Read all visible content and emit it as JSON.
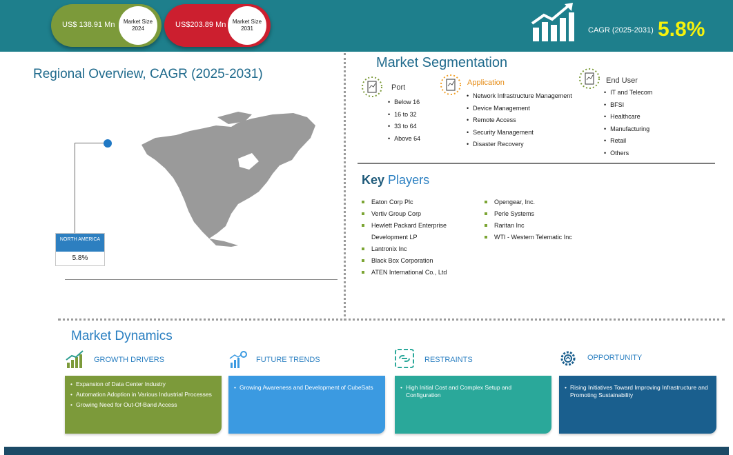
{
  "header": {
    "market_size_2024_value": "US$ 138.91 Mn",
    "market_size_2024_label": "Market Size 2024",
    "market_size_2031_value": "US$203.89 Mn",
    "market_size_2031_label": "Market Size 2031",
    "cagr_label": "CAGR (2025-2031)",
    "cagr_value": "5.8%",
    "colors": {
      "band": "#1e7f8c",
      "green": "#7c9a3a",
      "red": "#cc1f2f",
      "cagr": "#f6f20c"
    }
  },
  "regional": {
    "title": "Regional Overview, CAGR (2025-2031)",
    "region_name": "NORTH AMERICA",
    "region_cagr": "5.8%"
  },
  "segmentation": {
    "title": "Market Segmentation",
    "port": {
      "label": "Port",
      "items": [
        "Below 16",
        "16 to 32",
        "33 to 64",
        "Above 64"
      ]
    },
    "application": {
      "label": "Application",
      "items": [
        "Network Infrastructure Management",
        "Device Management",
        "Remote Access",
        "Security Management",
        "Disaster Recovery"
      ]
    },
    "end_user": {
      "label": "End User",
      "items": [
        "IT and Telecom",
        "BFSI",
        "Healthcare",
        "Manufacturing",
        "Retail",
        "Others"
      ]
    }
  },
  "key_players": {
    "title_key": "Key",
    "title_rest": "Players",
    "col1": [
      "Eaton Corp Plc",
      "Vertiv Group Corp",
      "Hewlett Packard Enterprise Development LP",
      "Lantronix Inc",
      "Black Box Corporation",
      "ATEN International Co., Ltd"
    ],
    "col2": [
      "Opengear, Inc.",
      "Perle Systems",
      "Raritan Inc",
      "WTI - Western Telematic Inc"
    ]
  },
  "dynamics": {
    "title": "Market Dynamics",
    "growth_drivers": {
      "label": "GROWTH DRIVERS",
      "color": "#7c9a3a",
      "items": [
        "Expansion of Data Center Industry",
        "Automation Adoption in Various Industrial Processes",
        "Growing Need for Out-Of-Band Access"
      ]
    },
    "future_trends": {
      "label": "FUTURE TRENDS",
      "color": "#3b9ae1",
      "items": [
        "Growing Awareness and Development of CubeSats"
      ]
    },
    "restraints": {
      "label": "RESTRAINTS",
      "color": "#2aa89a",
      "items": [
        "High Initial Cost and Complex Setup and Configuration"
      ]
    },
    "opportunity": {
      "label": "OPPORTUNITY",
      "color": "#1a5f8e",
      "items": [
        "Rising Initiatives Toward Improving Infrastructure and Promoting Sustainability"
      ]
    }
  }
}
